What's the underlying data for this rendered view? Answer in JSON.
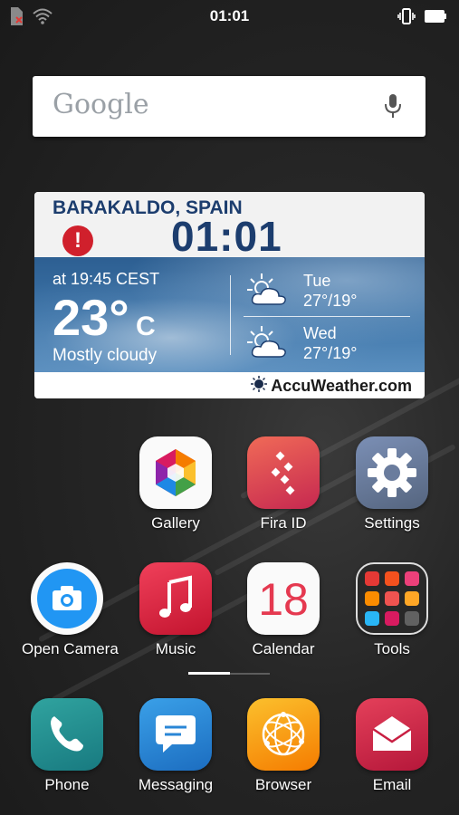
{
  "status_bar": {
    "time": "01:01"
  },
  "search": {
    "logo": "Google"
  },
  "weather": {
    "location": "BARAKALDO, SPAIN",
    "alert_symbol": "!",
    "clock": "01:01",
    "observed": "at 19:45 CEST",
    "temp": "23°",
    "unit": "C",
    "condition": "Mostly cloudy",
    "forecast": [
      {
        "day": "Tue",
        "temps": "27°/19°",
        "icon": "partly-cloudy-sun-icon"
      },
      {
        "day": "Wed",
        "temps": "27°/19°",
        "icon": "partly-cloudy-sun-icon"
      }
    ],
    "brand": "AccuWeather.com"
  },
  "apps": {
    "gallery": "Gallery",
    "fira_id": "Fira ID",
    "settings": "Settings",
    "open_camera": "Open Camera",
    "music": "Music",
    "calendar": "Calendar",
    "calendar_date": "18",
    "tools": "Tools"
  },
  "dock": {
    "phone": "Phone",
    "messaging": "Messaging",
    "browser": "Browser",
    "email": "Email"
  },
  "colors": {
    "weather_text": "#1c3d6e",
    "alert": "#d0202c"
  }
}
